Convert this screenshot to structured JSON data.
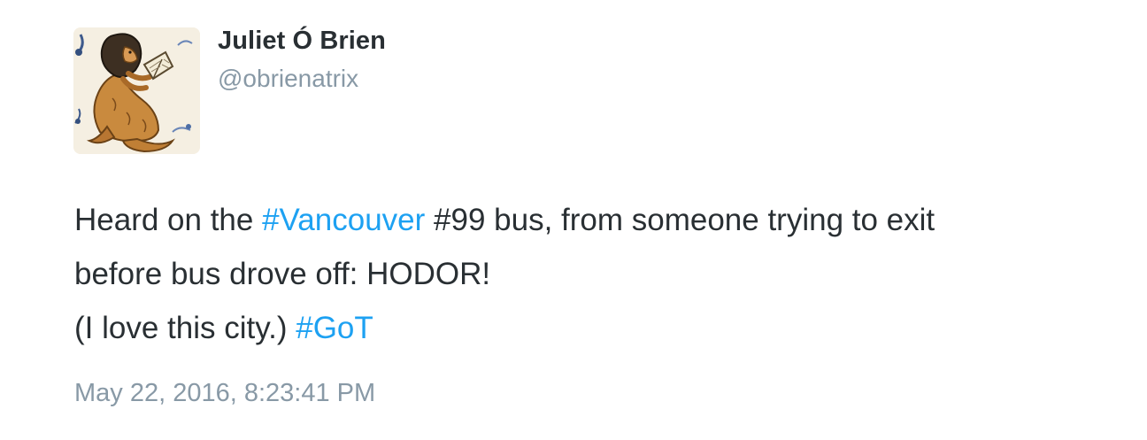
{
  "user": {
    "display_name": "Juliet Ó Brien",
    "handle": "@obrienatrix",
    "avatar_icon": "medieval-manuscript-beast-reading-icon"
  },
  "tweet": {
    "line1_a": "Heard on the ",
    "hashtag_vancouver": "#Vancouver",
    "line1_b": " #99 bus, from someone trying to exit",
    "line2": "before bus drove off: HODOR!",
    "line3_a": "(I love this city.) ",
    "hashtag_got": "#GoT",
    "timestamp": "May 22, 2016, 8:23:41 PM"
  },
  "colors": {
    "text": "#292f33",
    "secondary": "#8899a6",
    "link": "#1da1f2"
  }
}
